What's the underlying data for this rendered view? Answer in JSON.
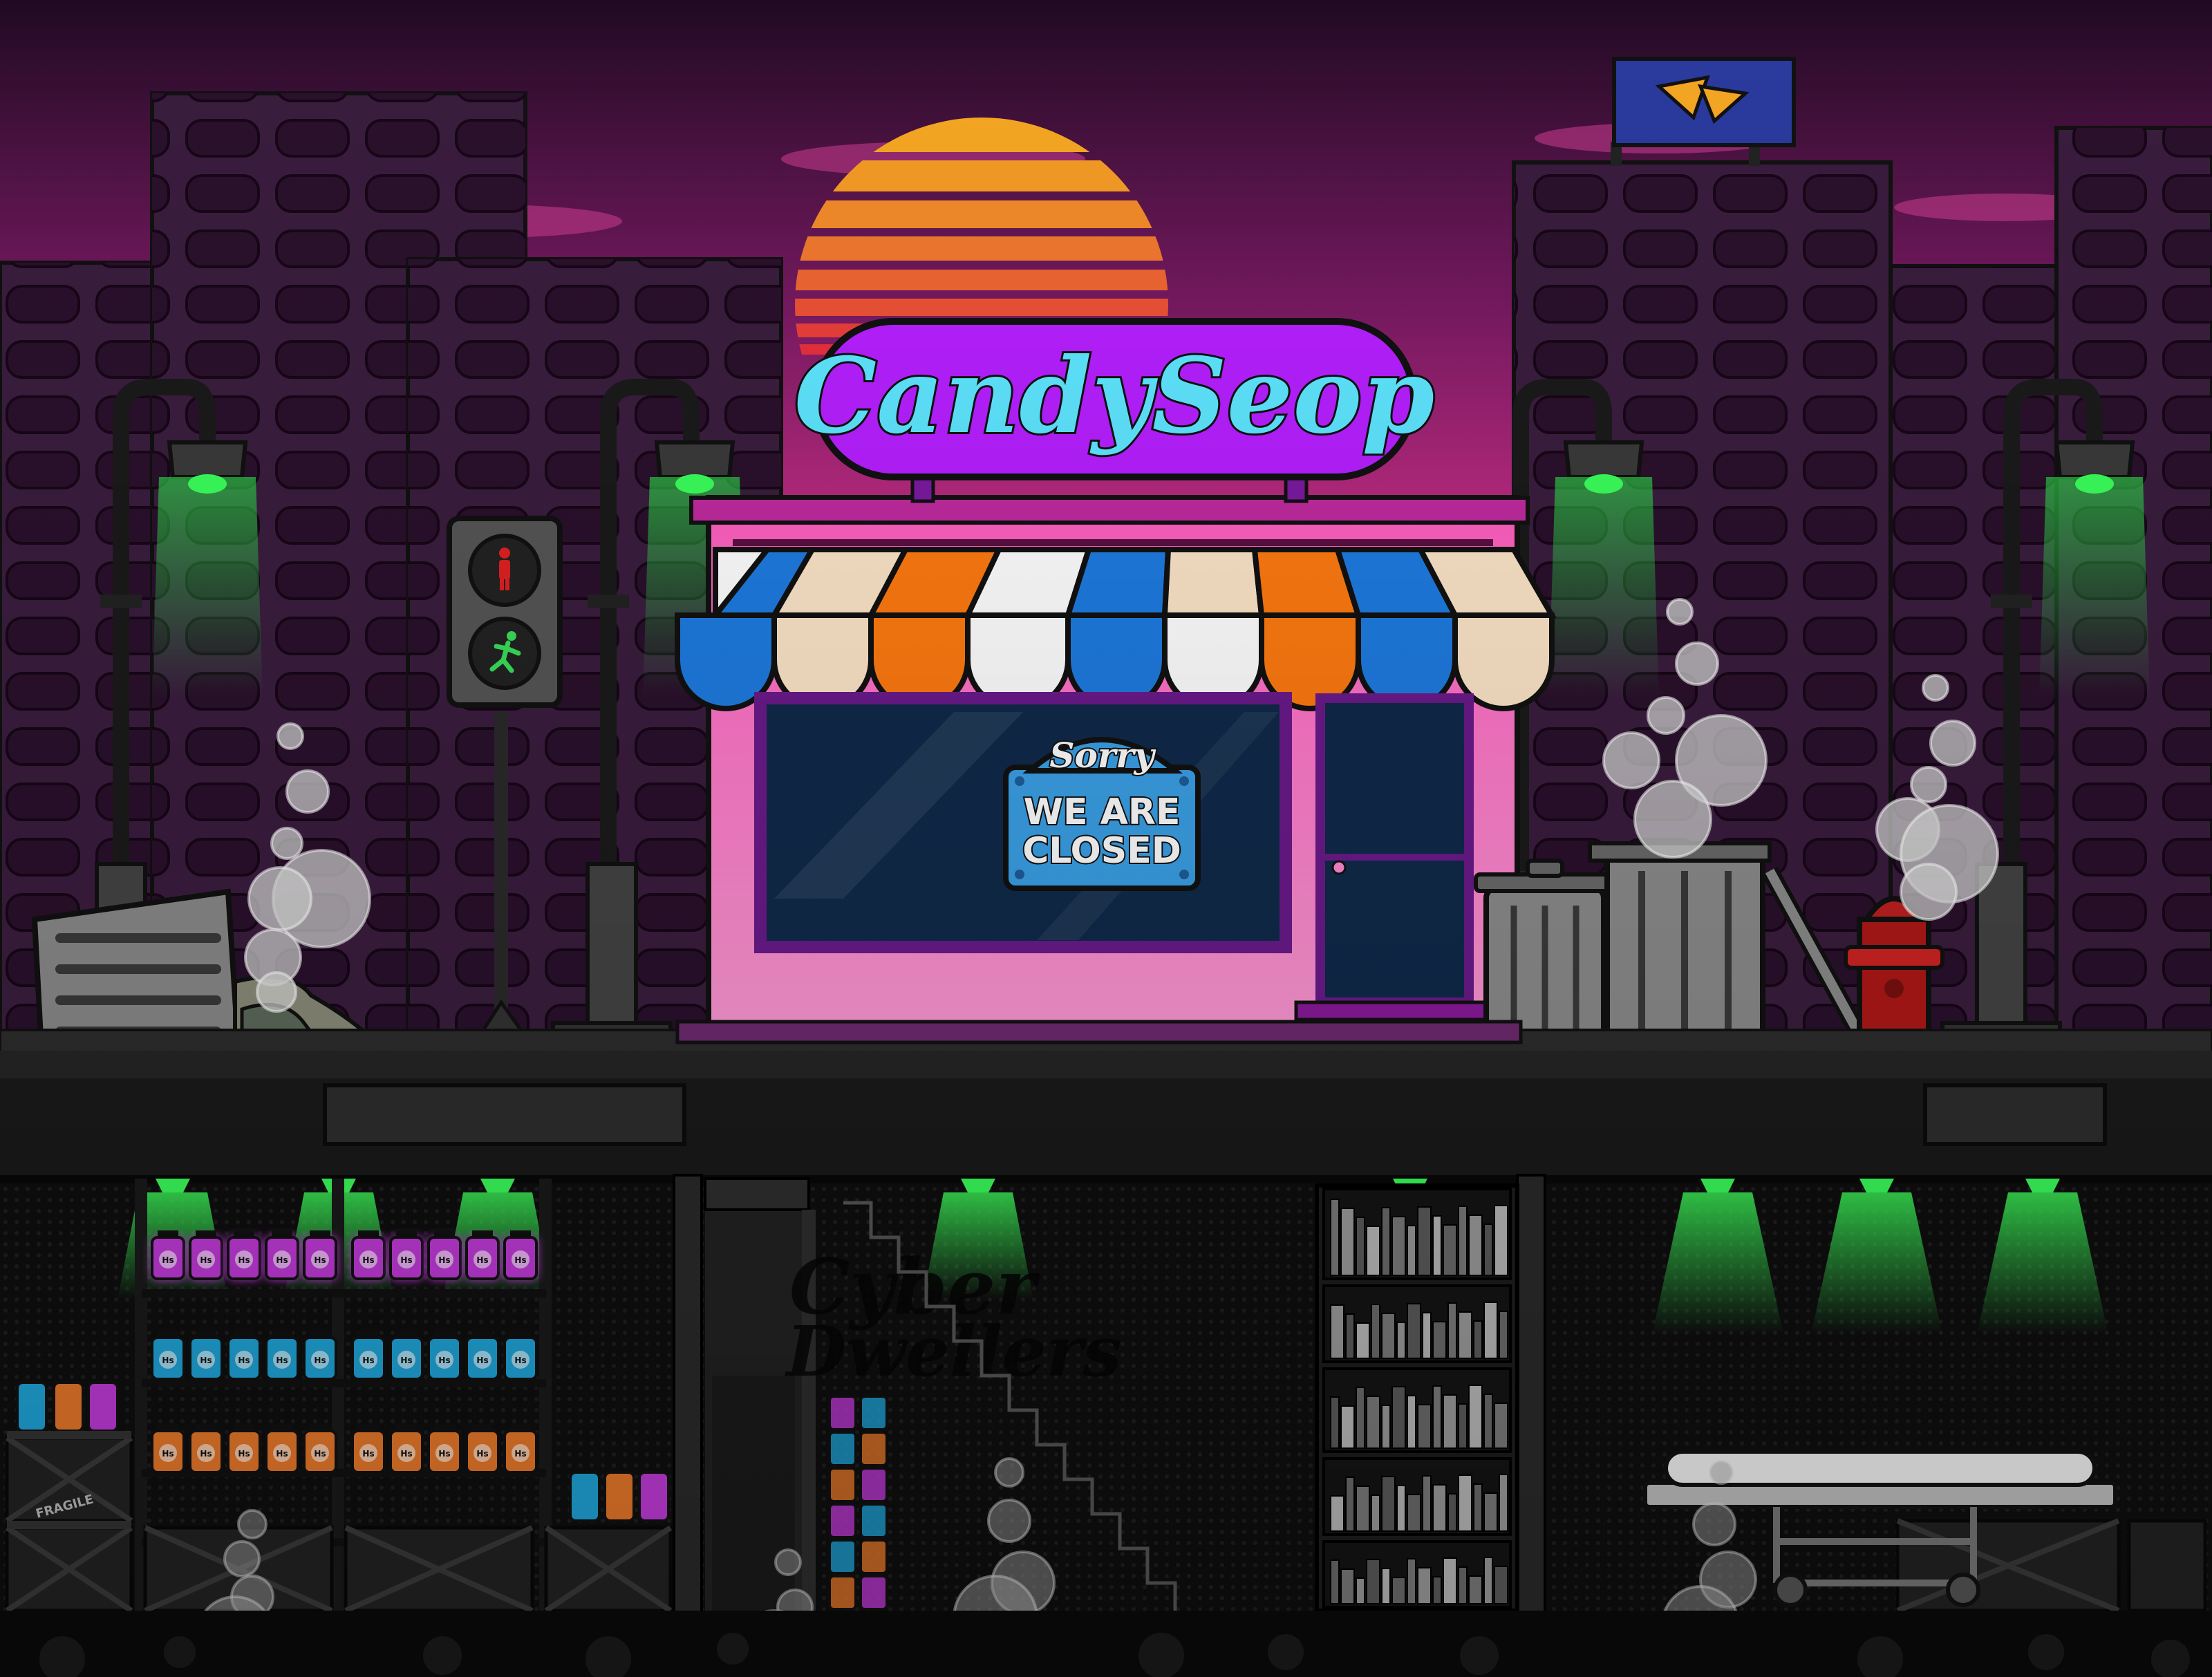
{
  "shop_sign": {
    "name": "CandySeop"
  },
  "closed_sign": {
    "top": "Sorry",
    "line1": "WE ARE",
    "line2": "CLOSED"
  },
  "graffiti": {
    "line1": "Cyber",
    "line2": "Dwellers"
  },
  "crate_label": "FRAGILE",
  "jar_label": "Hs",
  "colors": {
    "sky_top": "#2a0d2e",
    "sky_mid": "#8a1d6d",
    "sky_bottom": "#f0409a",
    "sun": "#f5a623",
    "building": "#3b1d3f",
    "window": "#2c1230",
    "sign_bg": "#b51fff",
    "sign_text": "#5ee6ff",
    "shop_wall": "#ff6ec7",
    "lamp_light": "#2ecc40",
    "closed_sign_bg": "#3aa0e6",
    "jar_purple": "#c03ad8",
    "jar_cyan": "#1fa4d8",
    "jar_orange": "#e8782a"
  },
  "icons": [
    "traffic-light-icon",
    "street-lamp-icon",
    "trash-can-icon",
    "fire-hydrant-icon",
    "billboard-logo-icon",
    "smoke-puff-icon",
    "stretcher-icon",
    "bookshelf-icon",
    "staircase-icon"
  ]
}
